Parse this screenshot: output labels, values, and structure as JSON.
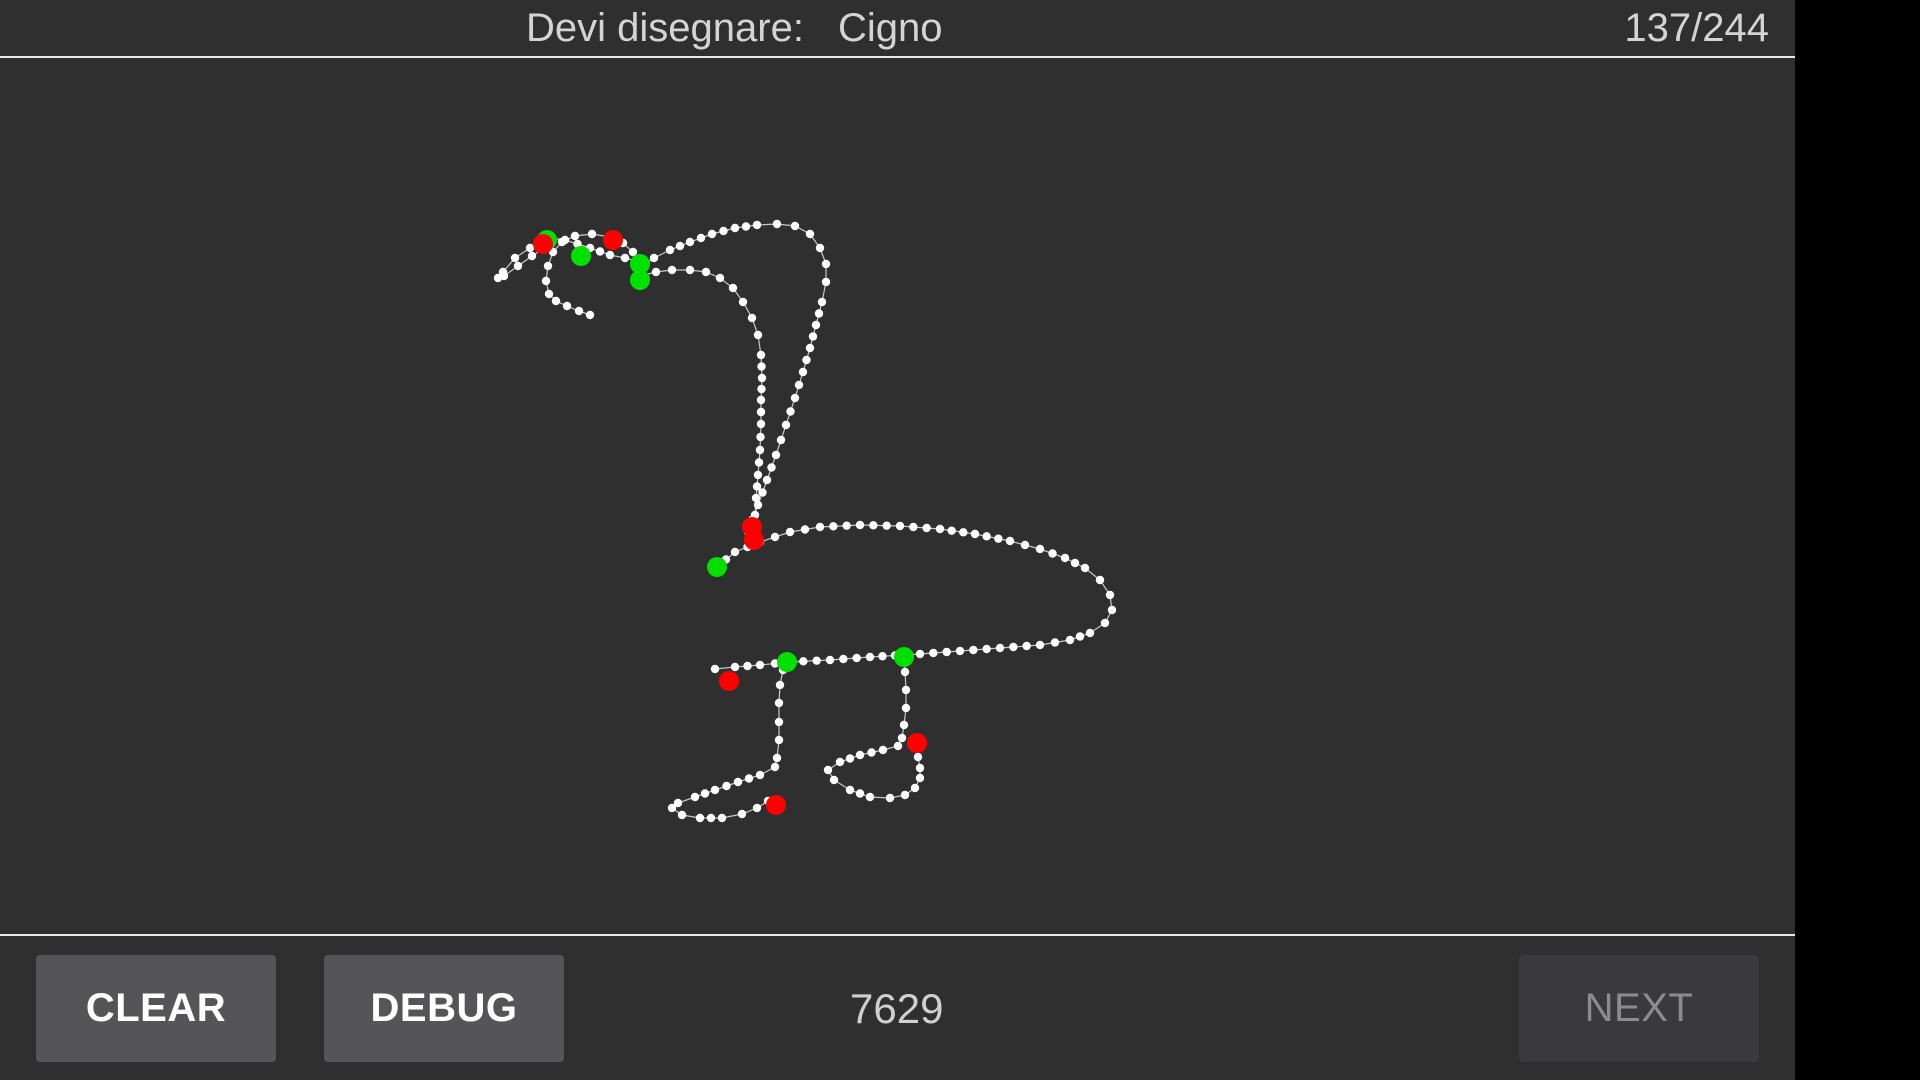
{
  "header": {
    "prompt_label": "Devi disegnare:",
    "prompt_word": "Cigno",
    "progress": "137/244"
  },
  "footer": {
    "clear_label": "CLEAR",
    "debug_label": "DEBUG",
    "score": "7629",
    "next_label": "NEXT"
  },
  "colors": {
    "background": "#2f2f2f",
    "stroke_point": "#ffffff",
    "stroke_start": "#00e000",
    "stroke_end": "#ff0000"
  }
}
